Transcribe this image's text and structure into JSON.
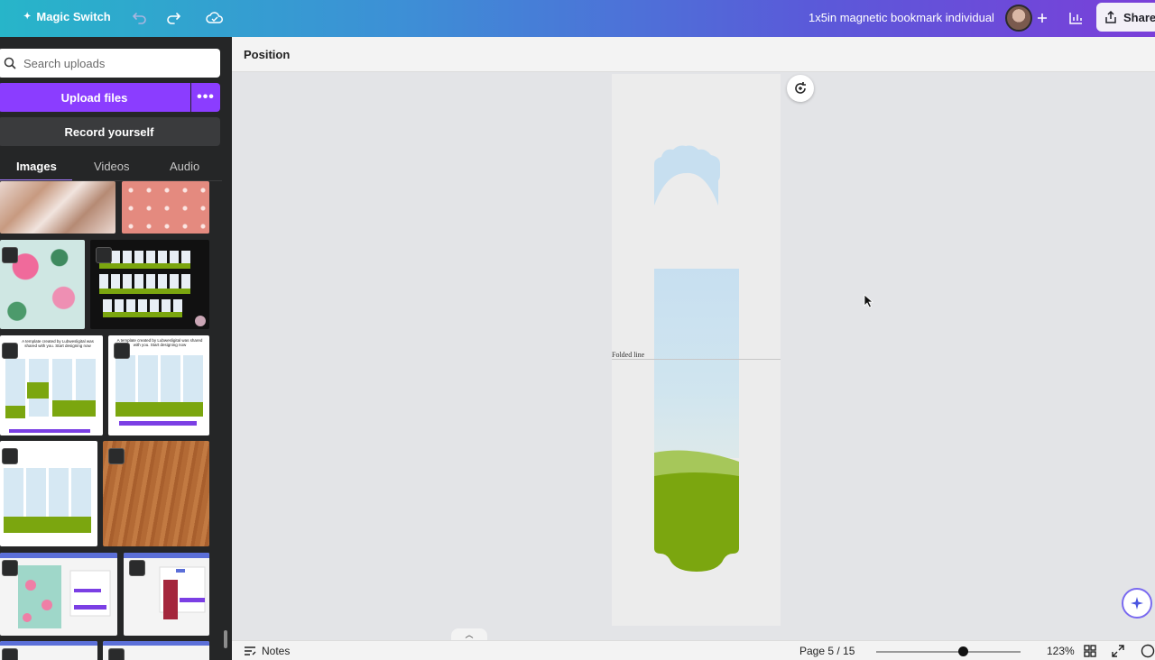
{
  "topbar": {
    "magic_switch_label": "Magic Switch",
    "document_title": "1x5in magnetic bookmark individual",
    "share_label": "Share"
  },
  "uploads_panel": {
    "search_placeholder": "Search uploads",
    "upload_label": "Upload files",
    "more_label": "•••",
    "record_label": "Record yourself",
    "tabs": [
      {
        "label": "Images",
        "active": true
      },
      {
        "label": "Videos",
        "active": false
      },
      {
        "label": "Audio",
        "active": false
      }
    ],
    "thumbnail_texts": {
      "template_note_1": "A template created by Lubwesligital was shared with you. Start designing now",
      "template_note_2": "A template created by Lubwesligital was shared with you. Start designing now"
    }
  },
  "toolbar": {
    "position_label": "Position"
  },
  "canvas": {
    "fold_label": "Folded line",
    "colors": {
      "sky_top": "#c7dff0",
      "sky_bottom": "#dbe9ef",
      "grass_light": "#a6c75a",
      "grass_dark": "#7ba60f"
    }
  },
  "bottombar": {
    "notes_label": "Notes",
    "page_indicator": "Page 5 / 15",
    "zoom_label": "123%",
    "zoom_fraction": 0.6
  },
  "icons": [
    "magic-wand-icon",
    "undo-icon",
    "redo-icon",
    "cloud-sync-icon",
    "plus-icon",
    "analytics-icon",
    "share-icon",
    "search-icon",
    "refresh-comment-icon",
    "magic-sparkle-icon",
    "notes-icon",
    "grid-view-icon",
    "fullscreen-icon",
    "help-icon"
  ]
}
